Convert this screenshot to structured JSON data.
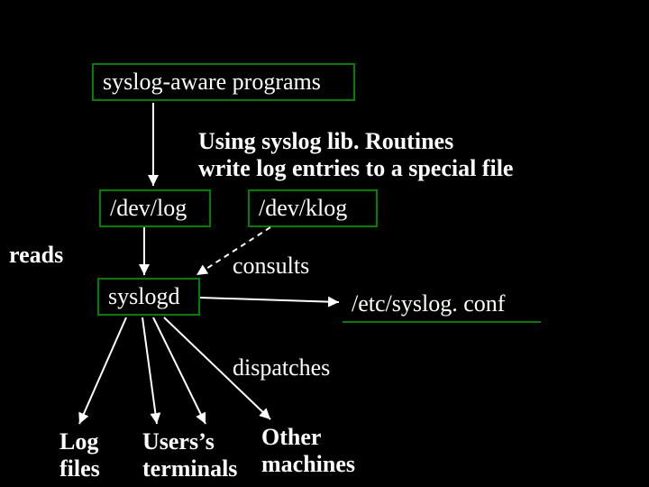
{
  "boxes": {
    "syslog_aware": "syslog-aware programs",
    "dev_log": "/dev/log",
    "dev_klog": "/dev/klog",
    "syslogd": "syslogd",
    "syslog_conf": "/etc/syslog. conf"
  },
  "labels": {
    "using_lib_1": "Using syslog lib. Routines",
    "using_lib_2": "write log entries to a special file",
    "reads": "reads",
    "consults": "consults",
    "dispatches": "dispatches",
    "log_files_1": "Log",
    "log_files_2": "files",
    "users_term_1": "Users’s",
    "users_term_2": "terminals",
    "other_mach_1": "Other",
    "other_mach_2": "machines"
  },
  "colors": {
    "box_border": "#008000",
    "text": "#ffffff",
    "bg": "#000000"
  }
}
